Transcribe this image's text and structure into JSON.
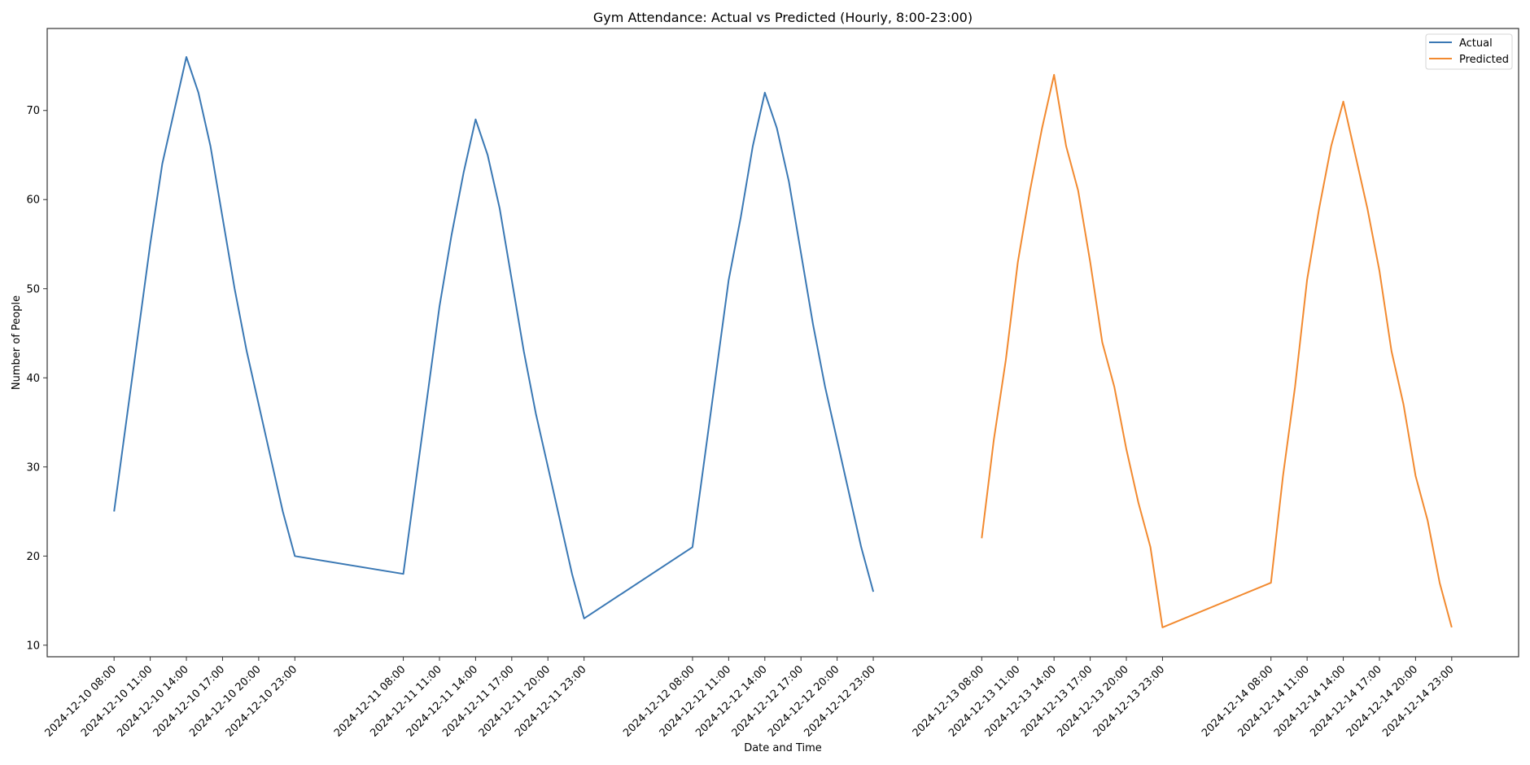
{
  "chart_data": {
    "type": "line",
    "title": "Gym Attendance: Actual vs Predicted (Hourly, 8:00-23:00)",
    "xlabel": "Date and Time",
    "ylabel": "Number of People",
    "ylim": [
      8.7,
      79.2
    ],
    "yticks": [
      10,
      20,
      30,
      40,
      50,
      60,
      70
    ],
    "grid": false,
    "legend": {
      "placement": "top-right",
      "entries": [
        "Actual",
        "Predicted"
      ]
    },
    "hours": [
      8,
      9,
      10,
      11,
      12,
      13,
      14,
      15,
      16,
      17,
      18,
      19,
      20,
      21,
      22,
      23
    ],
    "xtick_hours": [
      8,
      11,
      14,
      17,
      20,
      23
    ],
    "series": [
      {
        "name": "Actual",
        "color": "#3a78b4",
        "days": [
          {
            "date": "2024-12-10",
            "values": [
              25,
              35,
              45,
              55,
              64,
              70,
              76,
              72,
              66,
              58,
              50,
              43,
              37,
              31,
              25,
              20
            ]
          },
          {
            "date": "2024-12-11",
            "values": [
              18,
              28,
              38,
              48,
              56,
              63,
              69,
              65,
              59,
              51,
              43,
              36,
              30,
              24,
              18,
              13
            ]
          },
          {
            "date": "2024-12-12",
            "values": [
              21,
              31,
              41,
              51,
              58,
              66,
              72,
              68,
              62,
              54,
              46,
              39,
              33,
              27,
              21,
              16
            ]
          }
        ]
      },
      {
        "name": "Predicted",
        "color": "#f28a30",
        "days": [
          {
            "date": "2024-12-13",
            "values": [
              22,
              33,
              42,
              53,
              61,
              68,
              74,
              66,
              61,
              53,
              44,
              39,
              32,
              26,
              21,
              12
            ]
          },
          {
            "date": "2024-12-14",
            "values": [
              17,
              29,
              39,
              51,
              59,
              66,
              71,
              65,
              59,
              52,
              43,
              37,
              29,
              24,
              17,
              12
            ]
          }
        ]
      }
    ],
    "xticklabels": [
      "2024-12-10 08:00",
      "2024-12-10 11:00",
      "2024-12-10 14:00",
      "2024-12-10 17:00",
      "2024-12-10 20:00",
      "2024-12-10 23:00",
      "2024-12-11 08:00",
      "2024-12-11 11:00",
      "2024-12-11 14:00",
      "2024-12-11 17:00",
      "2024-12-11 20:00",
      "2024-12-11 23:00",
      "2024-12-12 08:00",
      "2024-12-12 11:00",
      "2024-12-12 14:00",
      "2024-12-12 17:00",
      "2024-12-12 20:00",
      "2024-12-12 23:00",
      "2024-12-13 08:00",
      "2024-12-13 11:00",
      "2024-12-13 14:00",
      "2024-12-13 17:00",
      "2024-12-13 20:00",
      "2024-12-13 23:00",
      "2024-12-14 08:00",
      "2024-12-14 11:00",
      "2024-12-14 14:00",
      "2024-12-14 17:00",
      "2024-12-14 20:00",
      "2024-12-14 23:00"
    ]
  }
}
